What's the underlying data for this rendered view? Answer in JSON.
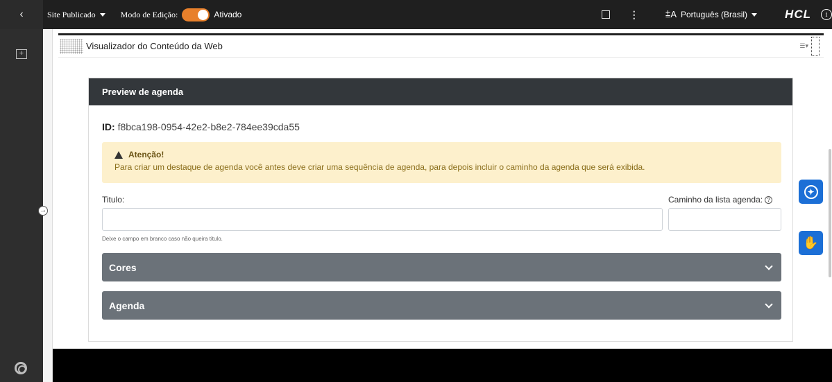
{
  "topbar": {
    "back_icon": "chevron-left-icon",
    "site_label": "Site Publicado",
    "mode_label": "Modo de Edição:",
    "mode_state": "Ativado",
    "toggle_color": "#e8802b",
    "language": "Português (Brasil)",
    "brand": "HCL"
  },
  "portlet": {
    "title": "Visualizador do Conteúdo da Web"
  },
  "card": {
    "header": "Preview de agenda",
    "id_label": "ID:",
    "id_value": "f8bca198-0954-42e2-b8e2-784ee39cda55",
    "alert_title": "Atenção!",
    "alert_text": "Para criar um destaque de agenda você antes deve criar uma sequência de agenda, para depois incluir o caminho da agenda que será exibida.",
    "title_label": "Titulo:",
    "title_value": "",
    "title_hint": "Deixe o campo em branco caso não queira titulo.",
    "path_label": "Caminho da lista agenda:",
    "path_value": "",
    "sections": [
      {
        "label": "Cores"
      },
      {
        "label": "Agenda"
      }
    ]
  },
  "colors": {
    "header_bg": "#33373b",
    "alert_bg": "#fdf0cc",
    "accordion_bg": "#6b7279",
    "accessibility_blue": "#1c6fd6"
  }
}
